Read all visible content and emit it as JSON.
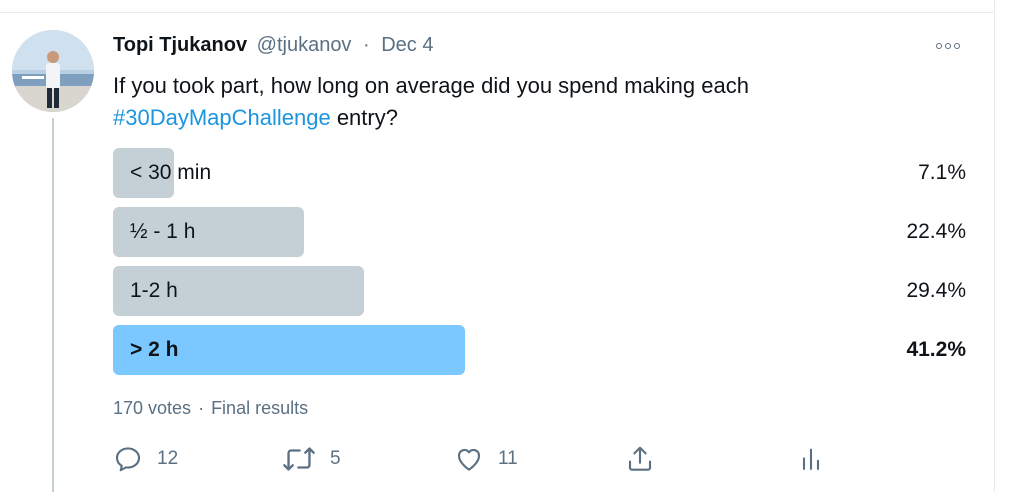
{
  "tweet": {
    "author_name": "Topi Tjukanov",
    "author_handle": "@tjukanov",
    "separator": "·",
    "date": "Dec 4",
    "text_before": "If you took part, how long on average did you spend making each ",
    "hashtag": "#30DayMapChallenge",
    "text_after": " entry?",
    "more_icon": "more-horizontal-icon"
  },
  "poll": {
    "options": [
      {
        "label": "< 30 min",
        "percent_text": "7.1%",
        "percent": 7.1,
        "winner": false
      },
      {
        "label": "½ - 1 h",
        "percent_text": "22.4%",
        "percent": 22.4,
        "winner": false
      },
      {
        "label": "1-2 h",
        "percent_text": "29.4%",
        "percent": 29.4,
        "winner": false
      },
      {
        "label": "> 2 h",
        "percent_text": "41.2%",
        "percent": 41.2,
        "winner": true
      }
    ],
    "votes": "170 votes",
    "separator": "·",
    "status": "Final results",
    "colors": {
      "bar": "#c4cfd6",
      "winner_bar": "#7ac8ff"
    }
  },
  "actions": {
    "reply": {
      "icon": "reply-icon",
      "count": "12"
    },
    "retweet": {
      "icon": "retweet-icon",
      "count": "5"
    },
    "like": {
      "icon": "heart-icon",
      "count": "11"
    },
    "share": {
      "icon": "share-icon"
    },
    "analytics": {
      "icon": "analytics-icon"
    }
  }
}
